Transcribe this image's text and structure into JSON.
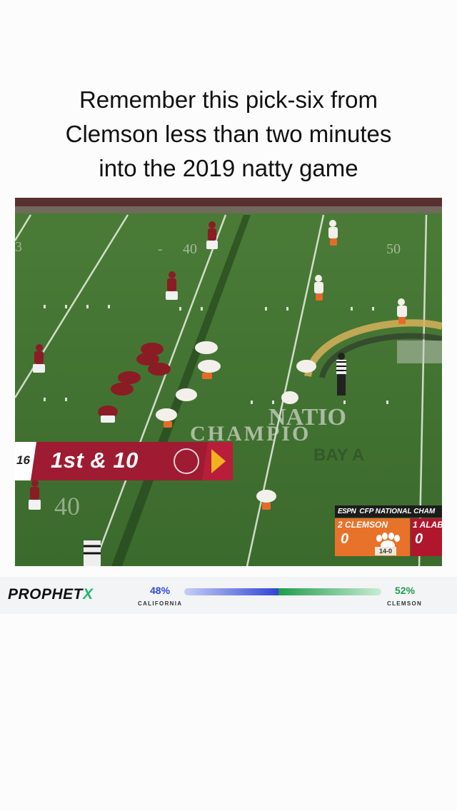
{
  "caption": {
    "lines": [
      "Remember this pick-six from",
      "Clemson less than two minutes",
      "into the 2019 natty game"
    ]
  },
  "broadcast": {
    "field_number": "16",
    "down_distance": "1st & 10",
    "yard_markers": [
      "40",
      "40",
      "50"
    ],
    "field_text_1": "NATIO",
    "field_text_2": "CHAMPIO",
    "field_text_3": "BAY A",
    "scoreboard": {
      "network": "ESPN",
      "event": "CFP NATIONAL CHAM",
      "team1_name": "2 CLEMSON",
      "team1_score": "0",
      "team2_name": "1 ALAB",
      "team2_score": "0",
      "record": "14-0"
    }
  },
  "prophetx": {
    "logo_main": "PROPHET",
    "logo_x": "X",
    "left_pct": "48%",
    "left_team": "CALIFORNIA",
    "right_pct": "52%",
    "right_team": "CLEMSON",
    "left_share": 48,
    "right_share": 52,
    "colors": {
      "left": "#2e46d3",
      "right": "#1f9c4d"
    }
  }
}
